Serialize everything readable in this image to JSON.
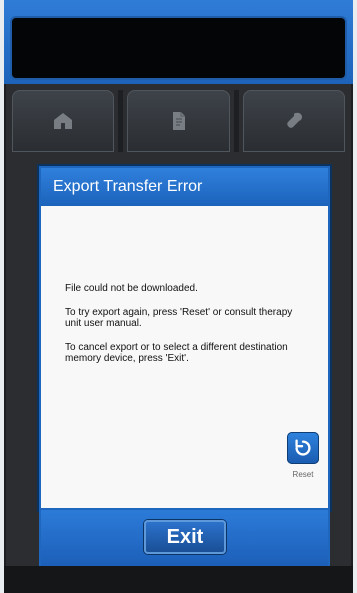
{
  "modal": {
    "title": "Export Transfer Error",
    "message_lines": [
      "File could not be downloaded.",
      "To try export again, press 'Reset' or consult therapy unit user manual.",
      "To cancel export or to select a different destination memory device, press 'Exit'."
    ],
    "reset": {
      "label": "Reset"
    }
  },
  "footer": {
    "exit_label": "Exit"
  },
  "tabs": [
    {
      "icon": "home-icon"
    },
    {
      "icon": "document-icon"
    },
    {
      "icon": "wrench-icon"
    }
  ]
}
